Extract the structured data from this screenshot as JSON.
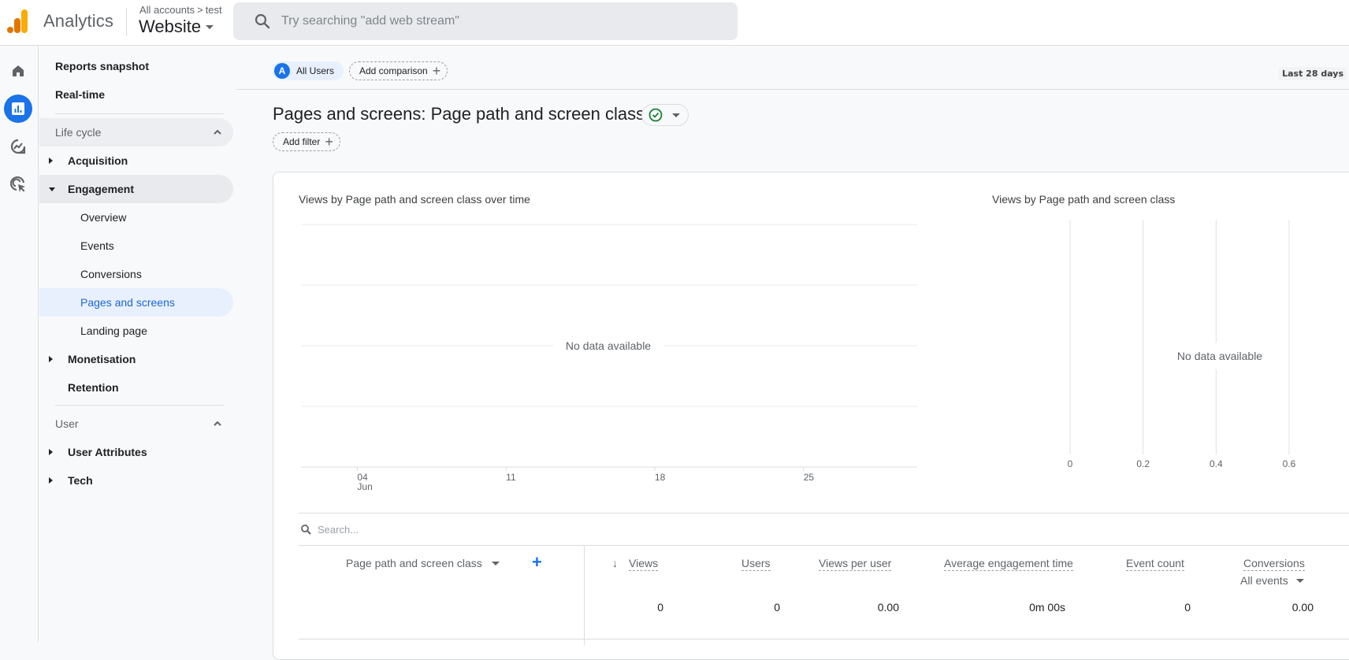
{
  "header": {
    "app_name": "Analytics",
    "breadcrumb": {
      "parent": "All accounts",
      "separator": ">",
      "account": "test"
    },
    "property": "Website",
    "search_placeholder": "Try searching \"add web stream\""
  },
  "rail": {
    "items": [
      {
        "name": "home",
        "icon": "home-icon"
      },
      {
        "name": "reports",
        "icon": "bar-chart-icon",
        "active": true
      },
      {
        "name": "explore",
        "icon": "explore-trend-icon"
      },
      {
        "name": "advertising",
        "icon": "ads-cursor-icon"
      }
    ]
  },
  "nav": {
    "top_items": [
      "Reports snapshot",
      "Real-time"
    ],
    "lifecycle": {
      "title": "Life cycle",
      "acquisition": "Acquisition",
      "engagement": "Engagement",
      "engagement_children": [
        "Overview",
        "Events",
        "Conversions",
        "Pages and screens",
        "Landing page"
      ],
      "monetisation": "Monetisation",
      "retention": "Retention"
    },
    "user": {
      "title": "User",
      "user_attributes": "User Attributes",
      "tech": "Tech"
    }
  },
  "toolbar": {
    "segment_avatar": "A",
    "segment_label": "All Users",
    "add_comparison": "Add comparison",
    "date_range": "Last 28 days"
  },
  "page": {
    "title": "Pages and screens: Page path and screen class",
    "add_filter": "Add filter",
    "status_color": "#188038"
  },
  "chart_data": [
    {
      "type": "line",
      "title": "Views by Page path and screen class over time",
      "x_ticks": [
        {
          "label": "04",
          "sublabel": "Jun"
        },
        {
          "label": "11",
          "sublabel": ""
        },
        {
          "label": "18",
          "sublabel": ""
        },
        {
          "label": "25",
          "sublabel": ""
        }
      ],
      "series": [],
      "empty_message": "No data available",
      "grid": true
    },
    {
      "type": "bar",
      "orientation": "horizontal",
      "title": "Views by Page path and screen class",
      "x_ticks": [
        "0",
        "0.2",
        "0.4",
        "0.6"
      ],
      "xlim": [
        0,
        0.6
      ],
      "categories": [],
      "values": [],
      "empty_message": "No data available",
      "grid": true
    }
  ],
  "table": {
    "search_placeholder": "Search...",
    "dimension_header": "Page path and screen class",
    "columns": [
      {
        "label": "Views",
        "sorted": "desc",
        "total": "0"
      },
      {
        "label": "Users",
        "total": "0"
      },
      {
        "label": "Views per user",
        "total": "0.00"
      },
      {
        "label": "Average engagement time",
        "total": "0m 00s"
      },
      {
        "label": "Event count",
        "total": "0"
      },
      {
        "label": "Conversions",
        "sub_select": "All events",
        "total": "0.00"
      }
    ]
  }
}
